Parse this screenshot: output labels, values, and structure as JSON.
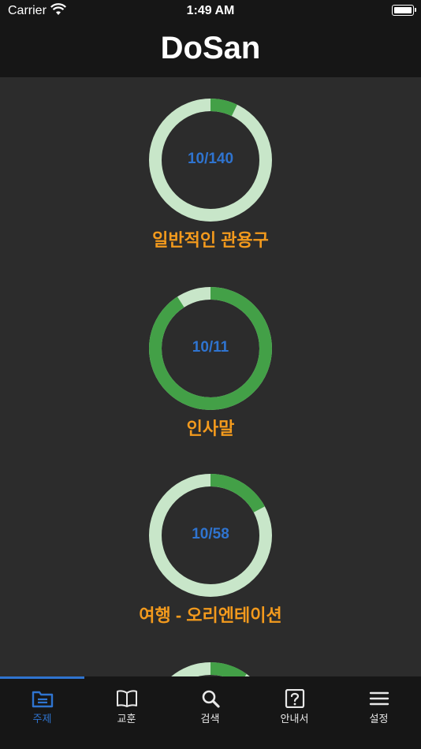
{
  "status": {
    "carrier": "Carrier",
    "time": "1:49 AM"
  },
  "app": {
    "title": "DoSan"
  },
  "topics": [
    {
      "count": "10/140",
      "name": "일반적인 관용구",
      "progress": 0.0714
    },
    {
      "count": "10/11",
      "name": "인사말",
      "progress": 0.909
    },
    {
      "count": "10/58",
      "name": "여행 - 오리엔테이션",
      "progress": 0.172
    },
    {
      "count": "",
      "name": "",
      "progress": 0.1
    }
  ],
  "colors": {
    "ring_track": "#c8e6c9",
    "ring_fill": "#43a047",
    "accent": "#2f74d0",
    "topic_name": "#f39a1d"
  },
  "tabs": [
    {
      "label": "주제",
      "icon": "folder-icon",
      "active": true
    },
    {
      "label": "교훈",
      "icon": "book-icon",
      "active": false
    },
    {
      "label": "검색",
      "icon": "search-icon",
      "active": false
    },
    {
      "label": "안내서",
      "icon": "help-icon",
      "active": false
    },
    {
      "label": "설정",
      "icon": "menu-icon",
      "active": false
    }
  ]
}
